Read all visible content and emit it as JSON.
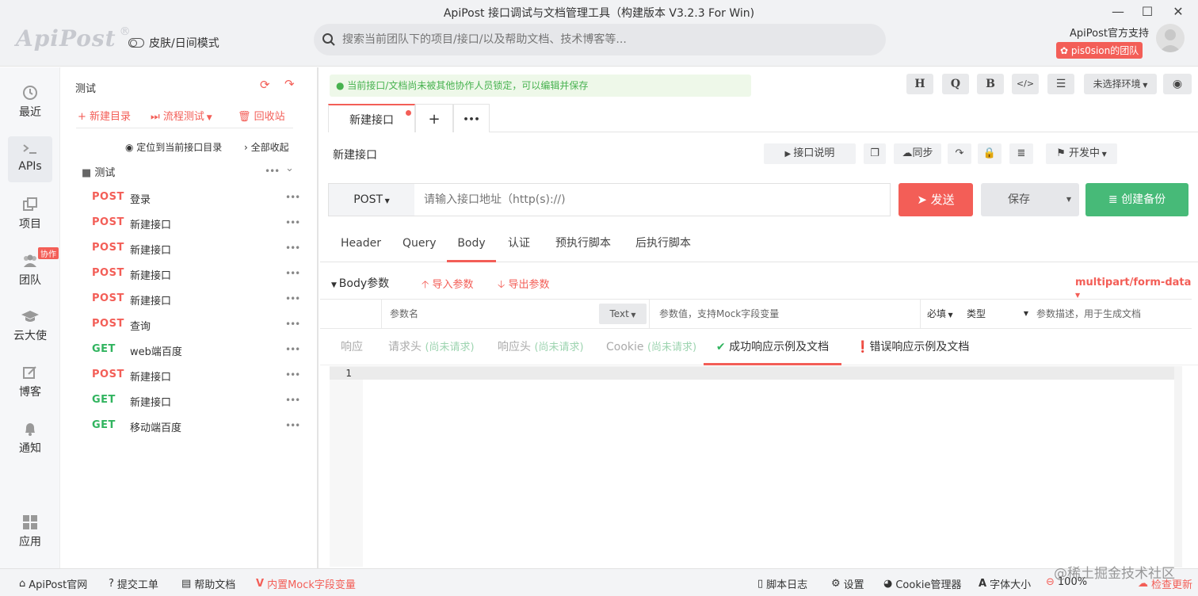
{
  "window": {
    "title": "ApiPost 接口调试与文档管理工具（构建版本 V3.2.3 For Win)",
    "minimize": "—",
    "maximize": "☐",
    "close": "✕"
  },
  "header": {
    "logo": "ApiPost",
    "logo_mark": "®",
    "skin_mode": "皮肤/日间模式",
    "search_placeholder": "搜索当前团队下的项目/接口/以及帮助文档、技术博客等...",
    "support": "ApiPost官方支持",
    "team": "pis0sion的团队"
  },
  "leftnav": {
    "items": [
      {
        "label": "最近",
        "icon": "clock-icon"
      },
      {
        "label": "APIs",
        "icon": "terminal-icon"
      },
      {
        "label": "项目",
        "icon": "project-icon"
      },
      {
        "label": "团队",
        "icon": "team-icon"
      },
      {
        "label": "云大使",
        "icon": "graduation-cap-icon"
      },
      {
        "label": "博客",
        "icon": "edit-icon"
      },
      {
        "label": "通知",
        "icon": "bell-icon"
      },
      {
        "label": "应用",
        "icon": "apps-grid-icon"
      }
    ],
    "collab_badge": "协作"
  },
  "tree": {
    "project": "测试",
    "new_folder": "新建目录",
    "flow_test": "流程测试",
    "recycle": "回收站",
    "locate": "定位到当前接口目录",
    "collapse_all": "全部收起",
    "folder": "测试",
    "folder_more": "•••",
    "apis": [
      {
        "method": "POST",
        "name": "登录"
      },
      {
        "method": "POST",
        "name": "新建接口"
      },
      {
        "method": "POST",
        "name": "新建接口"
      },
      {
        "method": "POST",
        "name": "新建接口"
      },
      {
        "method": "POST",
        "name": "新建接口"
      },
      {
        "method": "POST",
        "name": "查询"
      },
      {
        "method": "GET",
        "name": "web端百度"
      },
      {
        "method": "POST",
        "name": "新建接口"
      },
      {
        "method": "GET",
        "name": "新建接口"
      },
      {
        "method": "GET",
        "name": "移动端百度"
      }
    ],
    "item_more": "•••"
  },
  "main": {
    "lock_msg": "当前接口/文档尚未被其他协作人员锁定，可以编辑并保存",
    "toolbar": {
      "h": "H",
      "q": "Q",
      "b": "B",
      "code": "</>",
      "env": "未选择环境"
    },
    "tab_label": "新建接口",
    "tab_add": "+",
    "tab_more": "•••",
    "api_name": "新建接口",
    "api_desc": "接口说明",
    "sync": "同步",
    "status": "开发中",
    "method": "POST",
    "url_placeholder": "请输入接口地址（http(s)://)",
    "send": "发送",
    "save": "保存",
    "backup": "创建备份",
    "req_tabs": [
      "Header",
      "Query",
      "Body",
      "认证",
      "预执行脚本",
      "后执行脚本"
    ],
    "body_params": "Body参数",
    "import_params": "导入参数",
    "export_params": "导出参数",
    "content_type": "multipart/form-data",
    "param_name": "参数名",
    "param_type": "Text",
    "param_value": "参数值，支持Mock字段变量",
    "required": "必填",
    "type_label": "类型",
    "param_desc": "参数描述，用于生成文档",
    "resp_tabs": [
      {
        "label": "响应",
        "sub": ""
      },
      {
        "label": "请求头 ",
        "sub": "(尚未请求)"
      },
      {
        "label": "响应头 ",
        "sub": "(尚未请求)"
      },
      {
        "label": "Cookie ",
        "sub": "(尚未请求)"
      },
      {
        "label": "成功响应示例及文档",
        "sub": ""
      },
      {
        "label": "错误响应示例及文档",
        "sub": ""
      }
    ],
    "line_number": "1"
  },
  "footer": {
    "site": "ApiPost官网",
    "ticket": "提交工单",
    "help": "帮助文档",
    "mock": "内置Mock字段变量",
    "script_log": "脚本日志",
    "settings": "设置",
    "cookie_mgr": "Cookie管理器",
    "font_size": "字体大小",
    "zoom": "100%",
    "update": "检查更新",
    "watermark": "@稀土掘金技术社区"
  },
  "colors": {
    "accent": "#f35e57",
    "get": "#31b45f",
    "backup": "#47ba78",
    "lock_text": "#47b24f"
  }
}
